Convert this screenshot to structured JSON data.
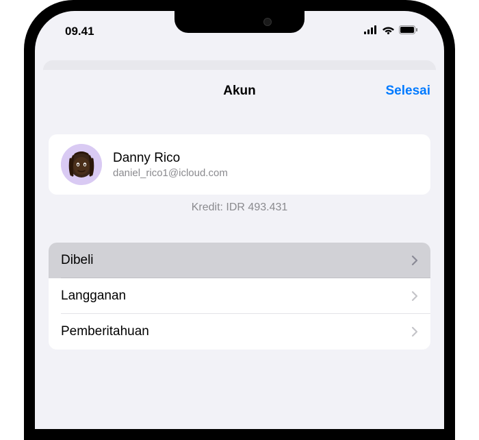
{
  "status_bar": {
    "time": "09.41"
  },
  "modal": {
    "title": "Akun",
    "done_label": "Selesai"
  },
  "profile": {
    "name": "Danny Rico",
    "email": "daniel_rico1@icloud.com",
    "credit": "Kredit: IDR 493.431"
  },
  "menu": {
    "items": [
      {
        "label": "Dibeli",
        "selected": true
      },
      {
        "label": "Langganan",
        "selected": false
      },
      {
        "label": "Pemberitahuan",
        "selected": false
      }
    ]
  }
}
